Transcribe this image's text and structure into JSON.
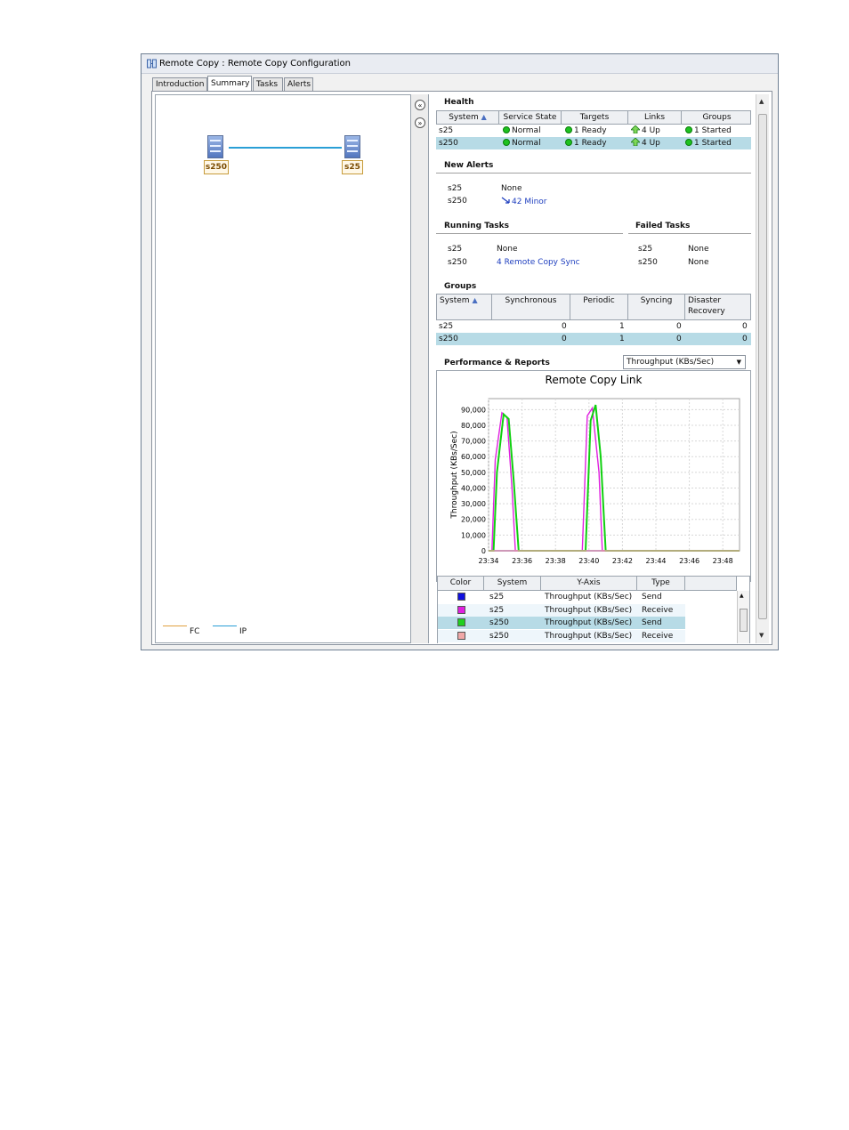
{
  "window": {
    "title": "Remote Copy : Remote Copy Configuration"
  },
  "tabs": [
    {
      "label": "Introduction",
      "active": false
    },
    {
      "label": "Summary",
      "active": true
    },
    {
      "label": "Tasks",
      "active": false
    },
    {
      "label": "Alerts",
      "active": false
    }
  ],
  "topology": {
    "nodes": [
      {
        "label": "s250"
      },
      {
        "label": "s25"
      }
    ],
    "link_legend": [
      {
        "label": "FC",
        "color": "#e0a040"
      },
      {
        "label": "IP",
        "color": "#2a9fd6"
      }
    ]
  },
  "health": {
    "title": "Health",
    "columns": [
      "System",
      "Service State",
      "Targets",
      "Links",
      "Groups"
    ],
    "rows": [
      {
        "system": "s25",
        "service_state": "Normal",
        "targets": "1 Ready",
        "links": "4 Up",
        "groups": "1 Started",
        "selected": false
      },
      {
        "system": "s250",
        "service_state": "Normal",
        "targets": "1 Ready",
        "links": "4 Up",
        "groups": "1 Started",
        "selected": true
      }
    ]
  },
  "new_alerts": {
    "title": "New Alerts",
    "rows": [
      {
        "system": "s25",
        "value": "None"
      },
      {
        "system": "s250",
        "value": "42 Minor"
      }
    ]
  },
  "running_tasks": {
    "title": "Running Tasks",
    "rows": [
      {
        "system": "s25",
        "value": "None"
      },
      {
        "system": "s250",
        "value": "4 Remote Copy Sync"
      }
    ]
  },
  "failed_tasks": {
    "title": "Failed Tasks",
    "rows": [
      {
        "system": "s25",
        "value": "None"
      },
      {
        "system": "s250",
        "value": "None"
      }
    ]
  },
  "groups": {
    "title": "Groups",
    "columns": [
      "System",
      "Synchronous",
      "Periodic",
      "Syncing",
      "Disaster",
      "Recovery"
    ],
    "rows": [
      {
        "system": "s25",
        "synchronous": "0",
        "periodic": "1",
        "syncing": "0",
        "dr": "0",
        "selected": false
      },
      {
        "system": "s250",
        "synchronous": "0",
        "periodic": "1",
        "syncing": "0",
        "dr": "0",
        "selected": true
      }
    ]
  },
  "performance": {
    "title": "Performance & Reports",
    "dropdown_value": "Throughput (KBs/Sec)"
  },
  "chart_data": {
    "type": "line",
    "title": "Remote Copy Link",
    "ylabel": "Throughput (KBs/Sec)",
    "xlabel": "",
    "x_ticks": [
      "23:34",
      "23:36",
      "23:38",
      "23:40",
      "23:42",
      "23:44",
      "23:46",
      "23:48"
    ],
    "y_ticks": [
      "0",
      "10,000",
      "20,000",
      "30,000",
      "40,000",
      "50,000",
      "60,000",
      "70,000",
      "80,000",
      "90,000"
    ],
    "ylim": [
      0,
      97000
    ],
    "xlim": [
      0,
      15
    ],
    "grid": true,
    "series": [
      {
        "color": "#0000ff",
        "x": [
          0,
          0.1,
          0.6,
          1.2,
          1.6,
          1.75,
          2,
          3,
          4,
          5,
          6,
          7,
          8,
          9,
          10,
          11,
          12,
          13,
          14,
          15
        ],
        "y": [
          0,
          0,
          0,
          0,
          0,
          0,
          0,
          0,
          0,
          0,
          0,
          0,
          0,
          0,
          0,
          0,
          0,
          0,
          0,
          0
        ]
      },
      {
        "color": "#e020e0",
        "x": [
          0,
          0.2,
          0.4,
          0.8,
          1.1,
          1.4,
          1.6,
          1.65,
          5.3,
          5.6,
          5.9,
          6.2,
          6.6,
          6.8,
          7.2,
          15
        ],
        "y": [
          0,
          0,
          58000,
          88000,
          85000,
          40000,
          0,
          0,
          0,
          0,
          86000,
          91000,
          50000,
          0,
          0,
          0
        ]
      },
      {
        "color": "#10d010",
        "x": [
          0,
          0.3,
          0.5,
          0.9,
          1.2,
          1.5,
          1.8,
          5.4,
          5.8,
          6.1,
          6.4,
          6.7,
          7.0,
          7.3,
          15
        ],
        "y": [
          0,
          0,
          50000,
          87000,
          84000,
          45000,
          0,
          0,
          0,
          83000,
          93000,
          60000,
          0,
          0,
          0
        ]
      },
      {
        "color": "#e8a0a0",
        "x": [
          0,
          15
        ],
        "y": [
          0,
          0
        ]
      }
    ]
  },
  "chart_legend": {
    "columns": [
      "Color",
      "System",
      "Y-Axis",
      "Type"
    ],
    "rows": [
      {
        "color": "#1010e0",
        "system": "s25",
        "yaxis": "Throughput (KBs/Sec)",
        "type": "Send",
        "selected": false
      },
      {
        "color": "#e020e0",
        "system": "s25",
        "yaxis": "Throughput (KBs/Sec)",
        "type": "Receive",
        "selected": false
      },
      {
        "color": "#20d020",
        "system": "s250",
        "yaxis": "Throughput (KBs/Sec)",
        "type": "Send",
        "selected": true
      },
      {
        "color": "#f0a8a8",
        "system": "s250",
        "yaxis": "Throughput (KBs/Sec)",
        "type": "Receive",
        "selected": false
      }
    ]
  }
}
